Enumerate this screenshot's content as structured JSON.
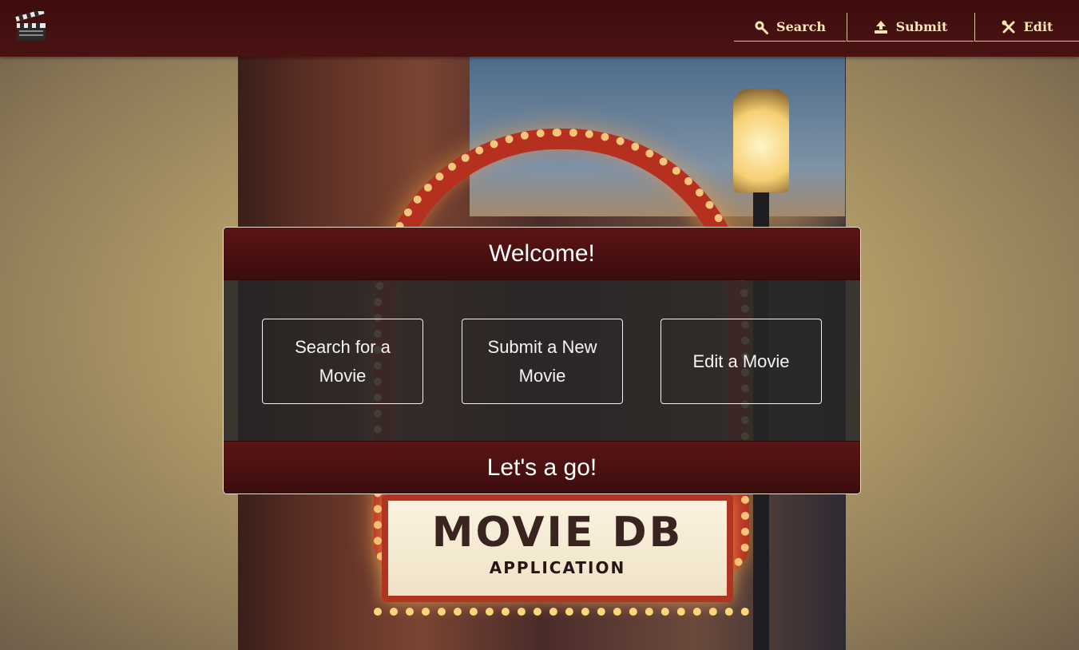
{
  "nav": {
    "logo_icon": "clapperboard-icon",
    "items": [
      {
        "label": "Search",
        "icon": "search-icon"
      },
      {
        "label": "Submit",
        "icon": "upload-icon"
      },
      {
        "label": "Edit",
        "icon": "tools-icon"
      }
    ]
  },
  "poster": {
    "title": "MOVIE DB",
    "subtitle": "APPLICATION"
  },
  "card": {
    "header": "Welcome!",
    "buttons": [
      {
        "label": "Search for a Movie"
      },
      {
        "label": "Submit a New Movie"
      },
      {
        "label": "Edit a Movie"
      }
    ],
    "footer": "Let's a go!"
  },
  "colors": {
    "navbar": "#3d0c0d",
    "nav_text": "#fbe6b4",
    "card_header": "#4a1212",
    "card_body": "#262626",
    "background": "#b9a36c"
  }
}
